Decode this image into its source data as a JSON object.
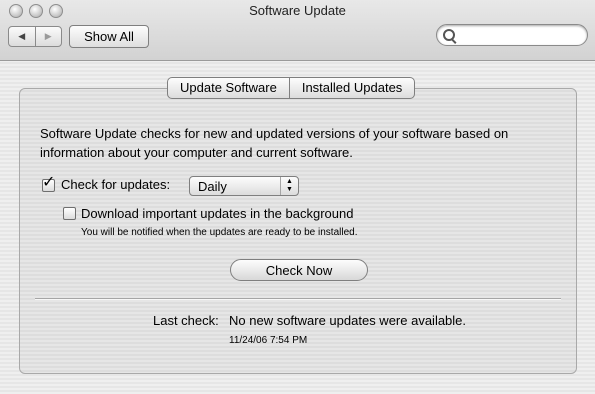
{
  "window": {
    "title": "Software Update"
  },
  "toolbar": {
    "back_glyph": "◀",
    "forward_glyph": "▶",
    "show_all_label": "Show All",
    "search_placeholder": "",
    "search_value": ""
  },
  "tabs": [
    {
      "label": "Update Software",
      "selected": true
    },
    {
      "label": "Installed Updates",
      "selected": false
    }
  ],
  "main": {
    "description": "Software Update checks for new and updated versions of your software based on information about your computer and current software.",
    "check_for_updates": {
      "label": "Check for updates:",
      "checked": true
    },
    "frequency": {
      "value": "Daily"
    },
    "download_background": {
      "label": "Download important updates in the background",
      "checked": false
    },
    "download_note": "You will be notified when the updates are ready to be installed.",
    "check_now_label": "Check Now",
    "last_check_label": "Last check:",
    "last_check_value": "No new software updates were available.",
    "last_check_time": "11/24/06 7:54 PM"
  }
}
